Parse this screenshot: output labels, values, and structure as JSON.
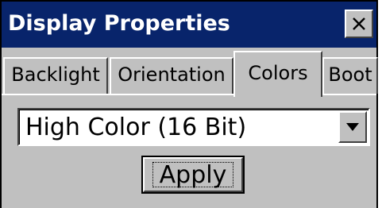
{
  "window": {
    "title": "Display Properties",
    "close_symbol": "close-icon"
  },
  "tabs": [
    {
      "label": "Backlight",
      "active": false
    },
    {
      "label": "Orientation",
      "active": false
    },
    {
      "label": "Colors",
      "active": true
    },
    {
      "label": "Boot",
      "active": false
    }
  ],
  "color_mode": {
    "selected": "High Color (16 Bit)",
    "arrow_icon": "chevron-down-icon"
  },
  "actions": {
    "apply_label": "Apply"
  },
  "colors": {
    "titlebar": "#08246b",
    "face": "#c0c0c0"
  }
}
